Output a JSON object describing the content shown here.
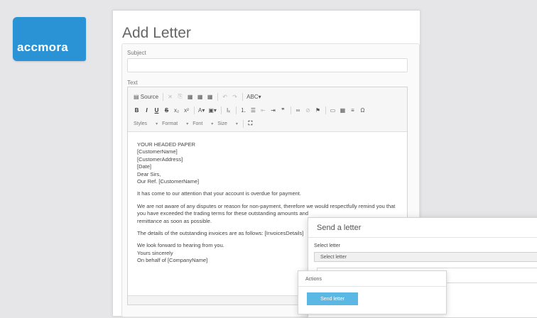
{
  "brand": {
    "logo_text": "accmora",
    "color": "#2a93d5"
  },
  "form": {
    "title": "Add Letter",
    "subject_label": "Subject",
    "subject_value": "",
    "text_label": "Text"
  },
  "toolbar": {
    "row1": [
      {
        "icon": "source-icon",
        "label": "▤ Source"
      },
      {
        "icon": "cut-icon",
        "label": "✕"
      },
      {
        "icon": "copy-icon",
        "label": "⎘"
      },
      {
        "icon": "paste-icon",
        "label": "▦"
      },
      {
        "icon": "paste-text-icon",
        "label": "▦"
      },
      {
        "icon": "paste-word-icon",
        "label": "▦"
      },
      {
        "icon": "undo-icon",
        "label": "↶"
      },
      {
        "icon": "redo-icon",
        "label": "↷"
      },
      {
        "icon": "spellcheck-icon",
        "label": "ABC▾"
      }
    ],
    "row2": [
      {
        "icon": "bold-icon",
        "label": "B"
      },
      {
        "icon": "italic-icon",
        "label": "I"
      },
      {
        "icon": "underline-icon",
        "label": "U"
      },
      {
        "icon": "strike-icon",
        "label": "S"
      },
      {
        "icon": "subscript-icon",
        "label": "x₂"
      },
      {
        "icon": "superscript-icon",
        "label": "x²"
      },
      {
        "icon": "text-color-icon",
        "label": "A▾"
      },
      {
        "icon": "bg-color-icon",
        "label": "▣▾"
      },
      {
        "icon": "remove-format-icon",
        "label": "Iₓ"
      },
      {
        "icon": "numbered-list-icon",
        "label": "⒈"
      },
      {
        "icon": "bullet-list-icon",
        "label": "☰"
      },
      {
        "icon": "outdent-icon",
        "label": "⇤"
      },
      {
        "icon": "indent-icon",
        "label": "⇥"
      },
      {
        "icon": "blockquote-icon",
        "label": "❞"
      },
      {
        "icon": "link-icon",
        "label": "∞"
      },
      {
        "icon": "unlink-icon",
        "label": "⊘"
      },
      {
        "icon": "anchor-icon",
        "label": "⚑"
      },
      {
        "icon": "image-icon",
        "label": "▭"
      },
      {
        "icon": "table-icon",
        "label": "▦"
      },
      {
        "icon": "hr-icon",
        "label": "≡"
      },
      {
        "icon": "special-char-icon",
        "label": "Ω"
      }
    ],
    "styles_label": "Styles",
    "format_label": "Format",
    "font_label": "Font",
    "size_label": "Size",
    "maximize_label": "⛶"
  },
  "letter": {
    "lines_block": [
      "YOUR HEADED PAPER",
      "[CustomerName]",
      "[CustomerAddress]",
      "[Date]",
      "Dear Sirs,",
      "Our Ref. [CustomerName]"
    ],
    "p1": "It has come to our attention that your account is overdue for payment.",
    "p2": "We are not aware of any disputes or reason for non-payment, therefore we would respectfully remind you that you have exceeded the trading terms for these outstanding amounts and",
    "p2b": "remittance as soon as possible.",
    "p3": "The details of the outstanding invoices are as follows: [InvoicesDetails]",
    "closing": [
      "We look forward to hearing from you.",
      "Yours sincerely",
      "On behalf of [CompanyName]"
    ]
  },
  "send_dialog": {
    "title": "Send a letter",
    "select_label": "Select letter",
    "select_value": "Select letter"
  },
  "actions_dialog": {
    "title": "Actions",
    "send_label": "Send letter",
    "button_color": "#5bb7e3"
  }
}
